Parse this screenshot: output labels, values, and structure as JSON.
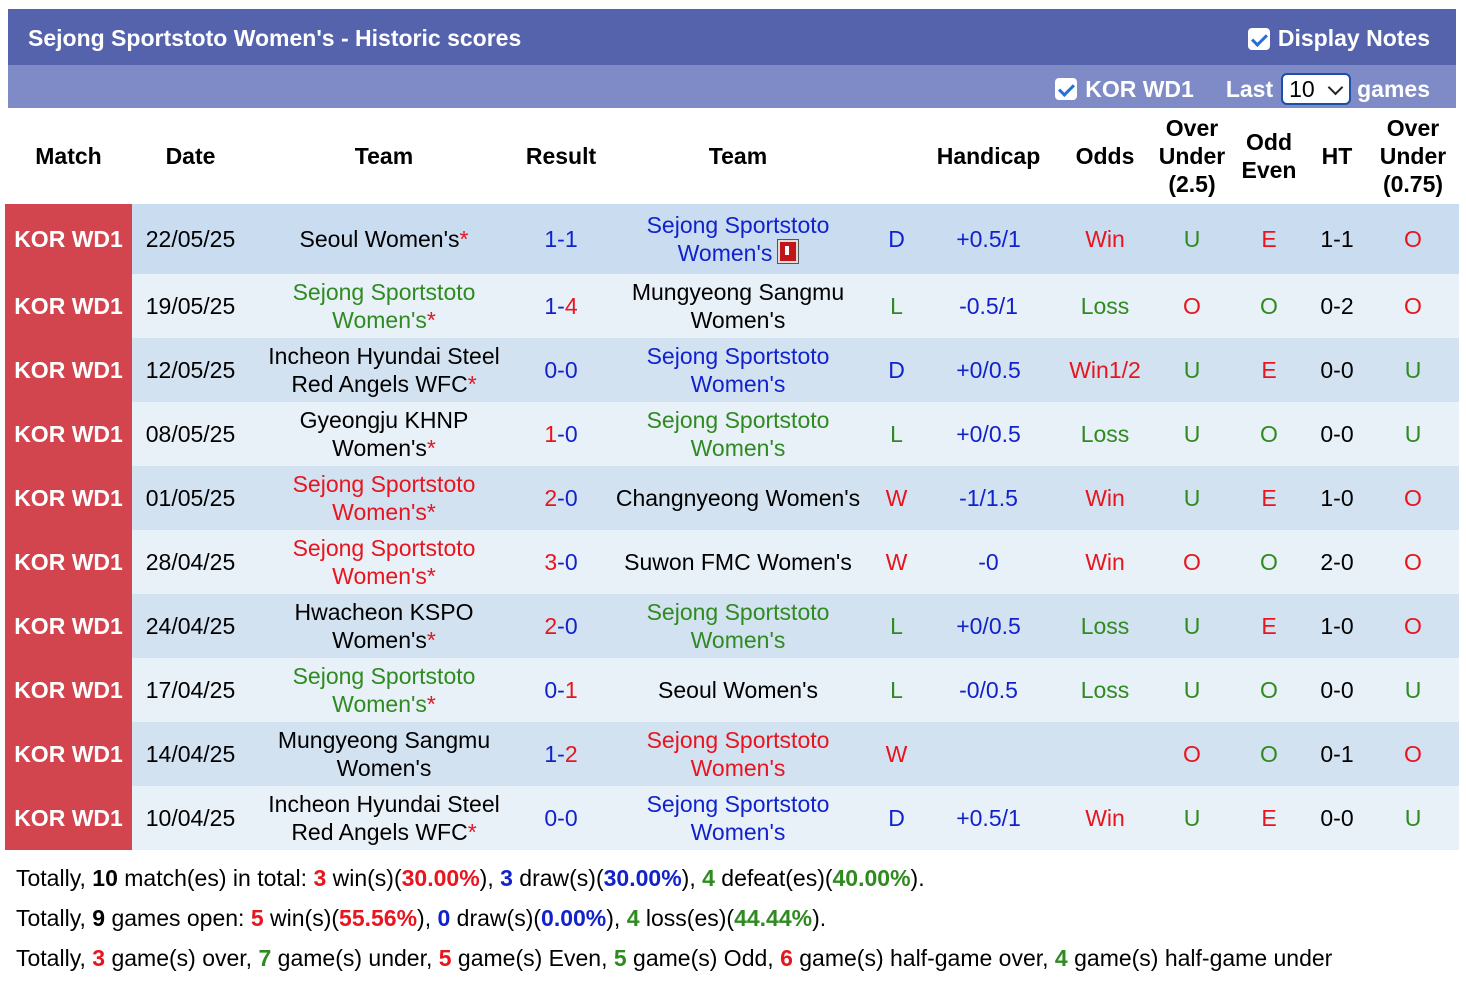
{
  "header": {
    "title": "Sejong Sportstoto Women's - Historic scores",
    "display_notes_label": "Display Notes",
    "league_filter_label": "KOR WD1",
    "last_label": "Last",
    "games_count": "10",
    "games_label": "games"
  },
  "columns": {
    "match": "Match",
    "date": "Date",
    "team_home": "Team",
    "result": "Result",
    "team_away": "Team",
    "handicap": "Handicap",
    "odds": "Odds",
    "ou_line1": "Over",
    "ou_line2": "Under",
    "ou_line3": "(2.5)",
    "oe_line1": "Odd",
    "oe_line2": "Even",
    "ht": "HT",
    "ou2_line1": "Over",
    "ou2_line2": "Under",
    "ou2_line3": "(0.75)"
  },
  "rows": [
    {
      "league": "KOR WD1",
      "date": "22/05/25",
      "home": [
        "Seoul Women's"
      ],
      "home_star": "*",
      "home_color": "#000000",
      "score_home": "1",
      "score_sep": "-",
      "score_away": "1",
      "score_home_color": "#1122cc",
      "score_away_color": "#1122cc",
      "away": [
        "Sejong Sportstoto",
        "Women's"
      ],
      "away_star": "",
      "away_color": "#1122cc",
      "red_card": true,
      "wdl": "D",
      "wdl_color": "#1122cc",
      "handicap": "+0.5/1",
      "hc_color": "#1122cc",
      "odds": "Win",
      "odds_color": "#e8141e",
      "ou": "U",
      "ou_color": "#2f8a20",
      "oe": "E",
      "oe_color": "#e8141e",
      "ht": "1-1",
      "ou2": "O",
      "ou2_color": "#e8141e"
    },
    {
      "league": "KOR WD1",
      "date": "19/05/25",
      "home": [
        "Sejong Sportstoto",
        "Women's"
      ],
      "home_star": "*",
      "home_color": "#2f8a20",
      "score_home": "1",
      "score_sep": "-",
      "score_away": "4",
      "score_home_color": "#1122cc",
      "score_away_color": "#e8141e",
      "away": [
        "Mungyeong Sangmu",
        "Women's"
      ],
      "away_star": "",
      "away_color": "#000000",
      "red_card": false,
      "wdl": "L",
      "wdl_color": "#2f8a20",
      "handicap": "-0.5/1",
      "hc_color": "#1122cc",
      "odds": "Loss",
      "odds_color": "#2f8a20",
      "ou": "O",
      "ou_color": "#e8141e",
      "oe": "O",
      "oe_color": "#2f8a20",
      "ht": "0-2",
      "ou2": "O",
      "ou2_color": "#e8141e"
    },
    {
      "league": "KOR WD1",
      "date": "12/05/25",
      "home": [
        "Incheon Hyundai Steel",
        "Red Angels WFC"
      ],
      "home_star": "*",
      "home_color": "#000000",
      "score_home": "0",
      "score_sep": "-",
      "score_away": "0",
      "score_home_color": "#1122cc",
      "score_away_color": "#1122cc",
      "away": [
        "Sejong Sportstoto",
        "Women's"
      ],
      "away_star": "",
      "away_color": "#1122cc",
      "red_card": false,
      "wdl": "D",
      "wdl_color": "#1122cc",
      "handicap": "+0/0.5",
      "hc_color": "#1122cc",
      "odds": "Win1/2",
      "odds_color": "#e8141e",
      "ou": "U",
      "ou_color": "#2f8a20",
      "oe": "E",
      "oe_color": "#e8141e",
      "ht": "0-0",
      "ou2": "U",
      "ou2_color": "#2f8a20"
    },
    {
      "league": "KOR WD1",
      "date": "08/05/25",
      "home": [
        "Gyeongju KHNP",
        "Women's"
      ],
      "home_star": "*",
      "home_color": "#000000",
      "score_home": "1",
      "score_sep": "-",
      "score_away": "0",
      "score_home_color": "#e8141e",
      "score_away_color": "#1122cc",
      "away": [
        "Sejong Sportstoto",
        "Women's"
      ],
      "away_star": "",
      "away_color": "#2f8a20",
      "red_card": false,
      "wdl": "L",
      "wdl_color": "#2f8a20",
      "handicap": "+0/0.5",
      "hc_color": "#1122cc",
      "odds": "Loss",
      "odds_color": "#2f8a20",
      "ou": "U",
      "ou_color": "#2f8a20",
      "oe": "O",
      "oe_color": "#2f8a20",
      "ht": "0-0",
      "ou2": "U",
      "ou2_color": "#2f8a20"
    },
    {
      "league": "KOR WD1",
      "date": "01/05/25",
      "home": [
        "Sejong Sportstoto",
        "Women's"
      ],
      "home_star": "*",
      "home_color": "#e8141e",
      "score_home": "2",
      "score_sep": "-",
      "score_away": "0",
      "score_home_color": "#e8141e",
      "score_away_color": "#1122cc",
      "away": [
        "Changnyeong Women's"
      ],
      "away_star": "",
      "away_color": "#000000",
      "red_card": false,
      "wdl": "W",
      "wdl_color": "#e8141e",
      "handicap": "-1/1.5",
      "hc_color": "#1122cc",
      "odds": "Win",
      "odds_color": "#e8141e",
      "ou": "U",
      "ou_color": "#2f8a20",
      "oe": "E",
      "oe_color": "#e8141e",
      "ht": "1-0",
      "ou2": "O",
      "ou2_color": "#e8141e"
    },
    {
      "league": "KOR WD1",
      "date": "28/04/25",
      "home": [
        "Sejong Sportstoto",
        "Women's"
      ],
      "home_star": "*",
      "home_color": "#e8141e",
      "score_home": "3",
      "score_sep": "-",
      "score_away": "0",
      "score_home_color": "#e8141e",
      "score_away_color": "#1122cc",
      "away": [
        "Suwon FMC Women's"
      ],
      "away_star": "",
      "away_color": "#000000",
      "red_card": false,
      "wdl": "W",
      "wdl_color": "#e8141e",
      "handicap": "-0",
      "hc_color": "#1122cc",
      "odds": "Win",
      "odds_color": "#e8141e",
      "ou": "O",
      "ou_color": "#e8141e",
      "oe": "O",
      "oe_color": "#2f8a20",
      "ht": "2-0",
      "ou2": "O",
      "ou2_color": "#e8141e"
    },
    {
      "league": "KOR WD1",
      "date": "24/04/25",
      "home": [
        "Hwacheon KSPO",
        "Women's"
      ],
      "home_star": "*",
      "home_color": "#000000",
      "score_home": "2",
      "score_sep": "-",
      "score_away": "0",
      "score_home_color": "#e8141e",
      "score_away_color": "#1122cc",
      "away": [
        "Sejong Sportstoto",
        "Women's"
      ],
      "away_star": "",
      "away_color": "#2f8a20",
      "red_card": false,
      "wdl": "L",
      "wdl_color": "#2f8a20",
      "handicap": "+0/0.5",
      "hc_color": "#1122cc",
      "odds": "Loss",
      "odds_color": "#2f8a20",
      "ou": "U",
      "ou_color": "#2f8a20",
      "oe": "E",
      "oe_color": "#e8141e",
      "ht": "1-0",
      "ou2": "O",
      "ou2_color": "#e8141e"
    },
    {
      "league": "KOR WD1",
      "date": "17/04/25",
      "home": [
        "Sejong Sportstoto",
        "Women's"
      ],
      "home_star": "*",
      "home_color": "#2f8a20",
      "score_home": "0",
      "score_sep": "-",
      "score_away": "1",
      "score_home_color": "#1122cc",
      "score_away_color": "#e8141e",
      "away": [
        "Seoul Women's"
      ],
      "away_star": "",
      "away_color": "#000000",
      "red_card": false,
      "wdl": "L",
      "wdl_color": "#2f8a20",
      "handicap": "-0/0.5",
      "hc_color": "#1122cc",
      "odds": "Loss",
      "odds_color": "#2f8a20",
      "ou": "U",
      "ou_color": "#2f8a20",
      "oe": "O",
      "oe_color": "#2f8a20",
      "ht": "0-0",
      "ou2": "U",
      "ou2_color": "#2f8a20"
    },
    {
      "league": "KOR WD1",
      "date": "14/04/25",
      "home": [
        "Mungyeong Sangmu",
        "Women's"
      ],
      "home_star": "",
      "home_color": "#000000",
      "score_home": "1",
      "score_sep": "-",
      "score_away": "2",
      "score_home_color": "#1122cc",
      "score_away_color": "#e8141e",
      "away": [
        "Sejong Sportstoto",
        "Women's"
      ],
      "away_star": "",
      "away_color": "#e8141e",
      "red_card": false,
      "wdl": "W",
      "wdl_color": "#e8141e",
      "handicap": "",
      "hc_color": "#1122cc",
      "odds": "",
      "odds_color": "#e8141e",
      "ou": "O",
      "ou_color": "#e8141e",
      "oe": "O",
      "oe_color": "#2f8a20",
      "ht": "0-1",
      "ou2": "O",
      "ou2_color": "#e8141e"
    },
    {
      "league": "KOR WD1",
      "date": "10/04/25",
      "home": [
        "Incheon Hyundai Steel",
        "Red Angels WFC"
      ],
      "home_star": "*",
      "home_color": "#000000",
      "score_home": "0",
      "score_sep": "-",
      "score_away": "0",
      "score_home_color": "#1122cc",
      "score_away_color": "#1122cc",
      "away": [
        "Sejong Sportstoto",
        "Women's"
      ],
      "away_star": "",
      "away_color": "#1122cc",
      "red_card": false,
      "wdl": "D",
      "wdl_color": "#1122cc",
      "handicap": "+0.5/1",
      "hc_color": "#1122cc",
      "odds": "Win",
      "odds_color": "#e8141e",
      "ou": "U",
      "ou_color": "#2f8a20",
      "oe": "E",
      "oe_color": "#e8141e",
      "ht": "0-0",
      "ou2": "U",
      "ou2_color": "#2f8a20"
    }
  ],
  "summary": [
    [
      {
        "t": "Totally, ",
        "c": "#000000",
        "b": false
      },
      {
        "t": "10",
        "c": "#000000",
        "b": true
      },
      {
        "t": " match(es) in total: ",
        "c": "#000000",
        "b": false
      },
      {
        "t": "3",
        "c": "#e8141e",
        "b": true
      },
      {
        "t": " win(s)(",
        "c": "#000000",
        "b": false
      },
      {
        "t": "30.00%",
        "c": "#e8141e",
        "b": true
      },
      {
        "t": "), ",
        "c": "#000000",
        "b": false
      },
      {
        "t": "3",
        "c": "#1122cc",
        "b": true
      },
      {
        "t": " draw(s)(",
        "c": "#000000",
        "b": false
      },
      {
        "t": "30.00%",
        "c": "#1122cc",
        "b": true
      },
      {
        "t": "), ",
        "c": "#000000",
        "b": false
      },
      {
        "t": "4",
        "c": "#2f8a20",
        "b": true
      },
      {
        "t": " defeat(es)(",
        "c": "#000000",
        "b": false
      },
      {
        "t": "40.00%",
        "c": "#2f8a20",
        "b": true
      },
      {
        "t": ").",
        "c": "#000000",
        "b": false
      }
    ],
    [
      {
        "t": "Totally, ",
        "c": "#000000",
        "b": false
      },
      {
        "t": "9",
        "c": "#000000",
        "b": true
      },
      {
        "t": " games open: ",
        "c": "#000000",
        "b": false
      },
      {
        "t": "5",
        "c": "#e8141e",
        "b": true
      },
      {
        "t": " win(s)(",
        "c": "#000000",
        "b": false
      },
      {
        "t": "55.56%",
        "c": "#e8141e",
        "b": true
      },
      {
        "t": "), ",
        "c": "#000000",
        "b": false
      },
      {
        "t": "0",
        "c": "#1122cc",
        "b": true
      },
      {
        "t": " draw(s)(",
        "c": "#000000",
        "b": false
      },
      {
        "t": "0.00%",
        "c": "#1122cc",
        "b": true
      },
      {
        "t": "), ",
        "c": "#000000",
        "b": false
      },
      {
        "t": "4",
        "c": "#2f8a20",
        "b": true
      },
      {
        "t": " loss(es)(",
        "c": "#000000",
        "b": false
      },
      {
        "t": "44.44%",
        "c": "#2f8a20",
        "b": true
      },
      {
        "t": ").",
        "c": "#000000",
        "b": false
      }
    ],
    [
      {
        "t": "Totally, ",
        "c": "#000000",
        "b": false
      },
      {
        "t": "3",
        "c": "#e8141e",
        "b": true
      },
      {
        "t": " game(s) over, ",
        "c": "#000000",
        "b": false
      },
      {
        "t": "7",
        "c": "#2f8a20",
        "b": true
      },
      {
        "t": " game(s) under, ",
        "c": "#000000",
        "b": false
      },
      {
        "t": "5",
        "c": "#e8141e",
        "b": true
      },
      {
        "t": " game(s) Even, ",
        "c": "#000000",
        "b": false
      },
      {
        "t": "5",
        "c": "#2f8a20",
        "b": true
      },
      {
        "t": " game(s) Odd, ",
        "c": "#000000",
        "b": false
      },
      {
        "t": "6",
        "c": "#e8141e",
        "b": true
      },
      {
        "t": " game(s) half-game over, ",
        "c": "#000000",
        "b": false
      },
      {
        "t": "4",
        "c": "#2f8a20",
        "b": true
      },
      {
        "t": " game(s) half-game under",
        "c": "#000000",
        "b": false
      }
    ]
  ],
  "colors": {
    "title_bar": "#5563ad",
    "filter_bar": "#7e8bc6",
    "league_cell": "#d2454f",
    "win": "#e8141e",
    "draw": "#1122cc",
    "loss": "#2f8a20"
  }
}
